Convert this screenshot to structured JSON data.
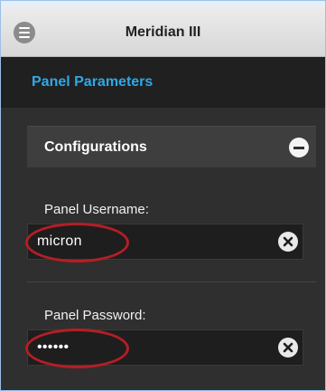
{
  "app": {
    "title": "Meridian III",
    "menu_icon": "menu-icon"
  },
  "section": {
    "title": "Panel Parameters"
  },
  "collapsible": {
    "label": "Configurations",
    "toggle_icon": "minus-circle-icon"
  },
  "fields": {
    "username": {
      "label": "Panel Username:",
      "value": "micron",
      "clear_icon": "clear-x-icon"
    },
    "password": {
      "label": "Panel Password:",
      "value": "••••••",
      "clear_icon": "clear-x-icon"
    }
  },
  "colors": {
    "accent": "#2fa8e6",
    "annotation": "#b41e26",
    "background": "#2f2f2f"
  }
}
